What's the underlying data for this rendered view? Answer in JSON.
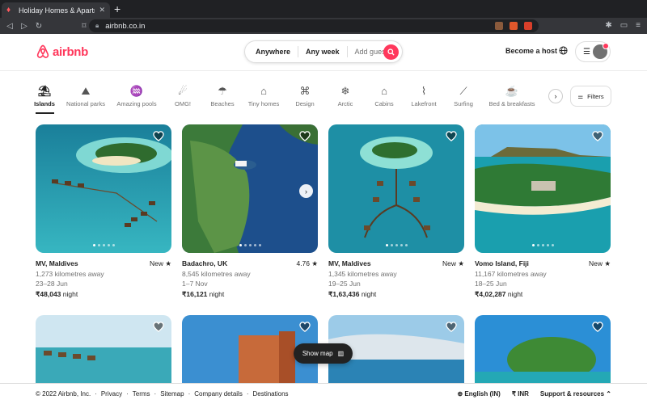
{
  "browser": {
    "tab_title": "Holiday Homes & Apartment Re",
    "url": "airbnb.co.in",
    "new_tab": "+"
  },
  "header": {
    "logo_text": "airbnb",
    "search": {
      "where": "Anywhere",
      "when": "Any week",
      "who": "Add guests"
    },
    "become_host": "Become a host"
  },
  "categories": [
    {
      "label": "Islands",
      "icon": "island-icon",
      "active": true
    },
    {
      "label": "National parks",
      "icon": "national-park-icon"
    },
    {
      "label": "Amazing pools",
      "icon": "pool-icon"
    },
    {
      "label": "OMG!",
      "icon": "ufo-icon"
    },
    {
      "label": "Beaches",
      "icon": "beach-umbrella-icon"
    },
    {
      "label": "Tiny homes",
      "icon": "tiny-home-icon"
    },
    {
      "label": "Design",
      "icon": "design-building-icon"
    },
    {
      "label": "Arctic",
      "icon": "snowflake-icon"
    },
    {
      "label": "Cabins",
      "icon": "cabin-icon"
    },
    {
      "label": "Lakefront",
      "icon": "lakefront-icon"
    },
    {
      "label": "Surfing",
      "icon": "surfboard-icon"
    },
    {
      "label": "Bed & breakfasts",
      "icon": "coffee-icon"
    }
  ],
  "filters_label": "Filters",
  "listings": [
    {
      "location": "MV, Maldives",
      "rating": "New",
      "distance": "1,273 kilometres away",
      "dates": "23–28 Jun",
      "price": "₹48,043",
      "price_unit": " night"
    },
    {
      "location": "Badachro, UK",
      "rating": "4.76",
      "distance": "8,545 kilometres away",
      "dates": "1–7 Nov",
      "price": "₹16,121",
      "price_unit": " night"
    },
    {
      "location": "MV, Maldives",
      "rating": "New",
      "distance": "1,345 kilometres away",
      "dates": "19–25 Jun",
      "price": "₹1,63,436",
      "price_unit": " night"
    },
    {
      "location": "Vomo Island, Fiji",
      "rating": "New",
      "distance": "11,167 kilometres away",
      "dates": "18–25 Jun",
      "price": "₹4,02,287",
      "price_unit": " night"
    }
  ],
  "show_map": "Show map",
  "footer": {
    "copyright": "© 2022 Airbnb, Inc.",
    "links": [
      "Privacy",
      "Terms",
      "Sitemap",
      "Company details",
      "Destinations"
    ],
    "sep": "·",
    "language": "English (IN)",
    "currency": "₹  INR",
    "support": "Support & resources"
  },
  "colors": {
    "brand": "#ff385c",
    "text": "#222222",
    "muted": "#717171"
  }
}
